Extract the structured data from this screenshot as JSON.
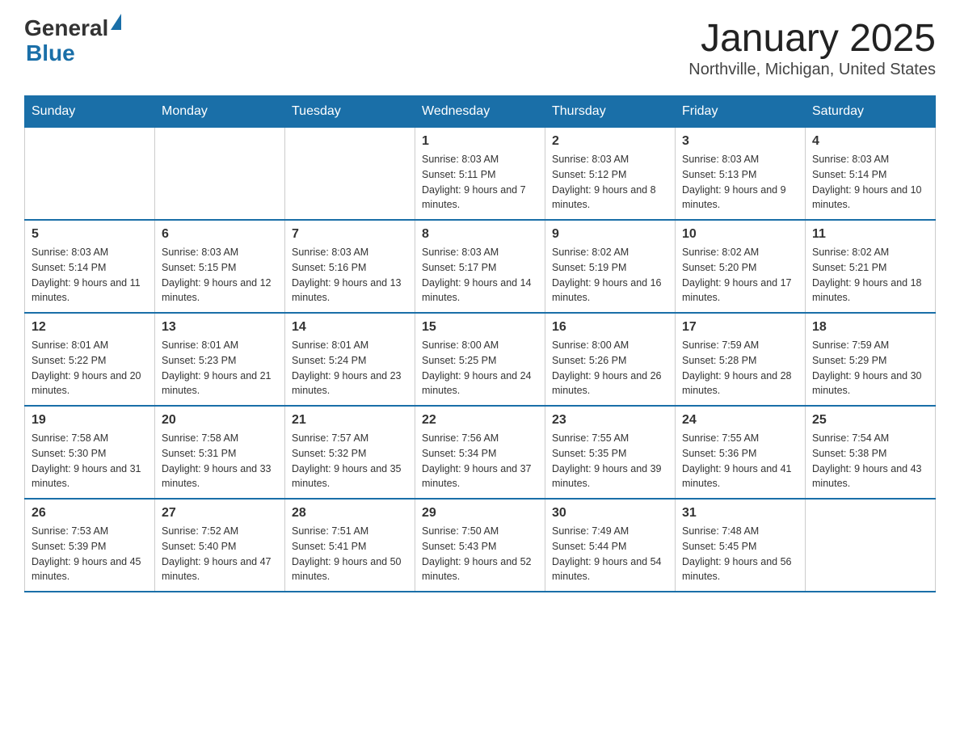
{
  "header": {
    "logo_general": "General",
    "logo_blue": "Blue",
    "month_title": "January 2025",
    "location": "Northville, Michigan, United States"
  },
  "weekdays": [
    "Sunday",
    "Monday",
    "Tuesday",
    "Wednesday",
    "Thursday",
    "Friday",
    "Saturday"
  ],
  "weeks": [
    [
      {
        "day": "",
        "info": ""
      },
      {
        "day": "",
        "info": ""
      },
      {
        "day": "",
        "info": ""
      },
      {
        "day": "1",
        "info": "Sunrise: 8:03 AM\nSunset: 5:11 PM\nDaylight: 9 hours and 7 minutes."
      },
      {
        "day": "2",
        "info": "Sunrise: 8:03 AM\nSunset: 5:12 PM\nDaylight: 9 hours and 8 minutes."
      },
      {
        "day": "3",
        "info": "Sunrise: 8:03 AM\nSunset: 5:13 PM\nDaylight: 9 hours and 9 minutes."
      },
      {
        "day": "4",
        "info": "Sunrise: 8:03 AM\nSunset: 5:14 PM\nDaylight: 9 hours and 10 minutes."
      }
    ],
    [
      {
        "day": "5",
        "info": "Sunrise: 8:03 AM\nSunset: 5:14 PM\nDaylight: 9 hours and 11 minutes."
      },
      {
        "day": "6",
        "info": "Sunrise: 8:03 AM\nSunset: 5:15 PM\nDaylight: 9 hours and 12 minutes."
      },
      {
        "day": "7",
        "info": "Sunrise: 8:03 AM\nSunset: 5:16 PM\nDaylight: 9 hours and 13 minutes."
      },
      {
        "day": "8",
        "info": "Sunrise: 8:03 AM\nSunset: 5:17 PM\nDaylight: 9 hours and 14 minutes."
      },
      {
        "day": "9",
        "info": "Sunrise: 8:02 AM\nSunset: 5:19 PM\nDaylight: 9 hours and 16 minutes."
      },
      {
        "day": "10",
        "info": "Sunrise: 8:02 AM\nSunset: 5:20 PM\nDaylight: 9 hours and 17 minutes."
      },
      {
        "day": "11",
        "info": "Sunrise: 8:02 AM\nSunset: 5:21 PM\nDaylight: 9 hours and 18 minutes."
      }
    ],
    [
      {
        "day": "12",
        "info": "Sunrise: 8:01 AM\nSunset: 5:22 PM\nDaylight: 9 hours and 20 minutes."
      },
      {
        "day": "13",
        "info": "Sunrise: 8:01 AM\nSunset: 5:23 PM\nDaylight: 9 hours and 21 minutes."
      },
      {
        "day": "14",
        "info": "Sunrise: 8:01 AM\nSunset: 5:24 PM\nDaylight: 9 hours and 23 minutes."
      },
      {
        "day": "15",
        "info": "Sunrise: 8:00 AM\nSunset: 5:25 PM\nDaylight: 9 hours and 24 minutes."
      },
      {
        "day": "16",
        "info": "Sunrise: 8:00 AM\nSunset: 5:26 PM\nDaylight: 9 hours and 26 minutes."
      },
      {
        "day": "17",
        "info": "Sunrise: 7:59 AM\nSunset: 5:28 PM\nDaylight: 9 hours and 28 minutes."
      },
      {
        "day": "18",
        "info": "Sunrise: 7:59 AM\nSunset: 5:29 PM\nDaylight: 9 hours and 30 minutes."
      }
    ],
    [
      {
        "day": "19",
        "info": "Sunrise: 7:58 AM\nSunset: 5:30 PM\nDaylight: 9 hours and 31 minutes."
      },
      {
        "day": "20",
        "info": "Sunrise: 7:58 AM\nSunset: 5:31 PM\nDaylight: 9 hours and 33 minutes."
      },
      {
        "day": "21",
        "info": "Sunrise: 7:57 AM\nSunset: 5:32 PM\nDaylight: 9 hours and 35 minutes."
      },
      {
        "day": "22",
        "info": "Sunrise: 7:56 AM\nSunset: 5:34 PM\nDaylight: 9 hours and 37 minutes."
      },
      {
        "day": "23",
        "info": "Sunrise: 7:55 AM\nSunset: 5:35 PM\nDaylight: 9 hours and 39 minutes."
      },
      {
        "day": "24",
        "info": "Sunrise: 7:55 AM\nSunset: 5:36 PM\nDaylight: 9 hours and 41 minutes."
      },
      {
        "day": "25",
        "info": "Sunrise: 7:54 AM\nSunset: 5:38 PM\nDaylight: 9 hours and 43 minutes."
      }
    ],
    [
      {
        "day": "26",
        "info": "Sunrise: 7:53 AM\nSunset: 5:39 PM\nDaylight: 9 hours and 45 minutes."
      },
      {
        "day": "27",
        "info": "Sunrise: 7:52 AM\nSunset: 5:40 PM\nDaylight: 9 hours and 47 minutes."
      },
      {
        "day": "28",
        "info": "Sunrise: 7:51 AM\nSunset: 5:41 PM\nDaylight: 9 hours and 50 minutes."
      },
      {
        "day": "29",
        "info": "Sunrise: 7:50 AM\nSunset: 5:43 PM\nDaylight: 9 hours and 52 minutes."
      },
      {
        "day": "30",
        "info": "Sunrise: 7:49 AM\nSunset: 5:44 PM\nDaylight: 9 hours and 54 minutes."
      },
      {
        "day": "31",
        "info": "Sunrise: 7:48 AM\nSunset: 5:45 PM\nDaylight: 9 hours and 56 minutes."
      },
      {
        "day": "",
        "info": ""
      }
    ]
  ]
}
